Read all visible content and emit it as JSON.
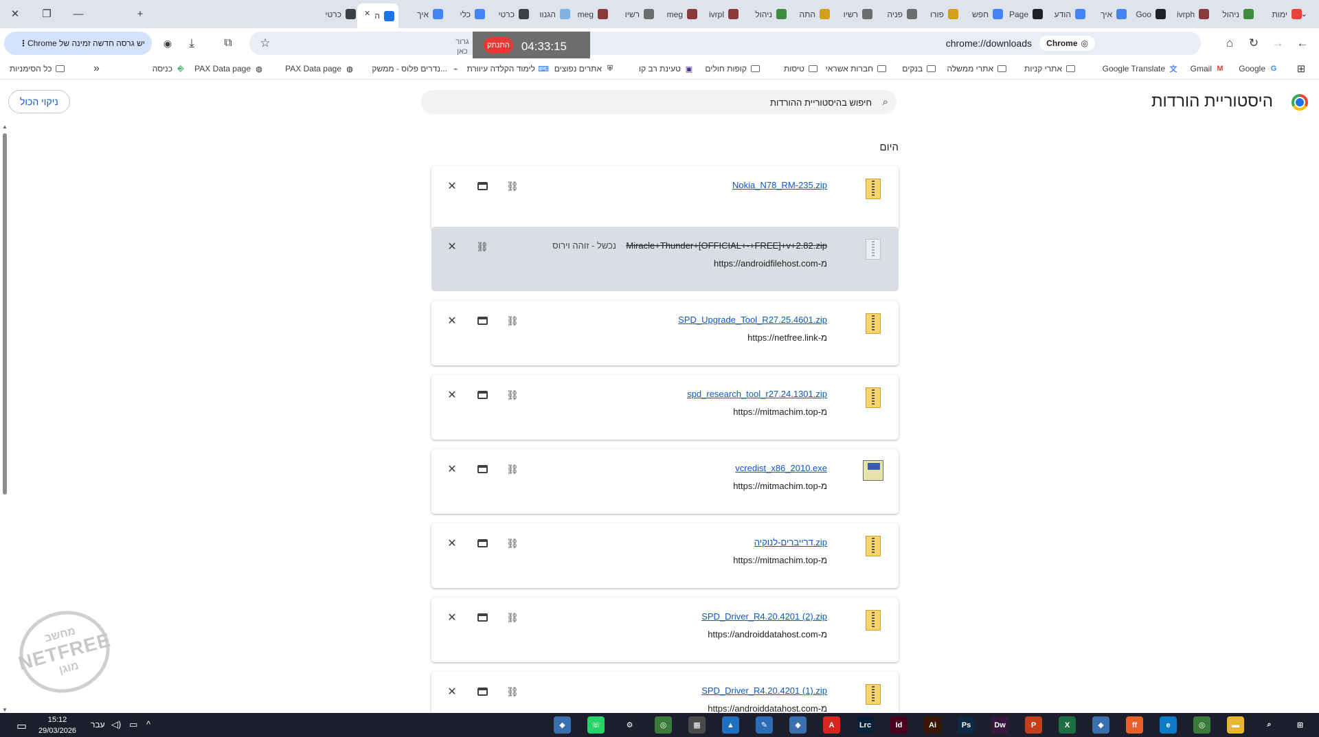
{
  "tabs": [
    {
      "label": "ימות",
      "icon": "gmail-icon",
      "color": "#ea4335"
    },
    {
      "label": "ניהול",
      "icon": "site-icon",
      "color": "#3d8b3d"
    },
    {
      "label": "ivrph",
      "icon": "shield-icon",
      "color": "#8a3a3a"
    },
    {
      "label": "Goo",
      "icon": "page-icon",
      "color": "#202124"
    },
    {
      "label": "איך",
      "icon": "google-icon",
      "color": "#4285f4"
    },
    {
      "label": "הודע",
      "icon": "google-icon",
      "color": "#4285f4"
    },
    {
      "label": "Page",
      "icon": "github-icon",
      "color": "#202124"
    },
    {
      "label": "חפש",
      "icon": "google-icon",
      "color": "#4285f4"
    },
    {
      "label": "פורו",
      "icon": "forum-icon",
      "color": "#d4a017"
    },
    {
      "label": "פניה",
      "icon": "shield-icon",
      "color": "#6d6d6d"
    },
    {
      "label": "רשיו",
      "icon": "shield-icon",
      "color": "#6d6d6d"
    },
    {
      "label": "התה",
      "icon": "site-icon",
      "color": "#d4a017"
    },
    {
      "label": "ניהול",
      "icon": "site-icon",
      "color": "#3d8b3d"
    },
    {
      "label": "ivrpl",
      "icon": "shield-icon",
      "color": "#8a3a3a"
    },
    {
      "label": "meg",
      "icon": "shield-icon",
      "color": "#8a3a3a"
    },
    {
      "label": "רשיו",
      "icon": "shield-icon",
      "color": "#6d6d6d"
    },
    {
      "label": "meg",
      "icon": "shield-icon",
      "color": "#8a3a3a"
    },
    {
      "label": "הגנוו",
      "icon": "snow-icon",
      "color": "#7fb2e5"
    },
    {
      "label": "כרטי",
      "icon": "chrome-icon",
      "color": "#3c4043"
    },
    {
      "label": "כלי",
      "icon": "google-icon",
      "color": "#4285f4"
    },
    {
      "label": "איך",
      "icon": "google-icon",
      "color": "#4285f4"
    },
    {
      "label": "ה",
      "icon": "download-icon",
      "color": "#1a73e8",
      "active": true
    },
    {
      "label": "כרטי",
      "icon": "chrome-icon",
      "color": "#3c4043"
    }
  ],
  "toolbar": {
    "url": "chrome://downloads",
    "chip_label": "Chrome",
    "update_label": "יש גרסה חדשה זמינה של Chrome"
  },
  "bookmarks": [
    {
      "label": "Google",
      "icon": "google-icon"
    },
    {
      "label": "Gmail",
      "icon": "gmail-icon"
    },
    {
      "label": "Google Translate",
      "icon": "translate-icon"
    },
    {
      "label": "אתרי קניות",
      "icon": "folder-icon"
    },
    {
      "label": "אתרי ממשלה",
      "icon": "folder-icon"
    },
    {
      "label": "בנקים",
      "icon": "folder-icon"
    },
    {
      "label": "חברות אשראי",
      "icon": "folder-icon"
    },
    {
      "label": "טיסות",
      "icon": "folder-icon"
    },
    {
      "label": "קופות חולים",
      "icon": "folder-icon"
    },
    {
      "label": "טעינת רב קו",
      "icon": "ravkav-icon"
    },
    {
      "label": "אתרים נפוצים",
      "icon": "shield-icon"
    },
    {
      "label": "לימוד הקלדה עיוורת",
      "icon": "typing-icon"
    },
    {
      "label": "נדרים פלוס - ממשק...",
      "icon": "link-icon"
    },
    {
      "label": "PAX Data page",
      "icon": "globe-icon"
    },
    {
      "label": "PAX Data page",
      "icon": "globe-icon"
    },
    {
      "label": "כניסה",
      "icon": "login-icon"
    }
  ],
  "bookmarks_more": "»",
  "bookmarks_all": "כל הסימניות",
  "page": {
    "title": "היסטוריית הורדות",
    "search_placeholder": "חיפוש בהיסטוריית ההורדות",
    "clear_all": "ניקוי הכול",
    "section": "היום"
  },
  "downloads": [
    {
      "file": "Nokia_N78_RM-235.zip",
      "source": "",
      "status": "",
      "failed": false,
      "icon": "zip-icon"
    },
    {
      "file": "Miracle+Thunder+[OFFICIAL+-+FREE]+v+2.82.zip",
      "source": "https://androidfilehost.com-מ",
      "status": "נכשל - זוהה וירוס",
      "failed": true,
      "icon": "zip-icon"
    },
    {
      "file": "SPD_Upgrade_Tool_R27.25.4601.zip",
      "source": "https://netfree.link-מ",
      "status": "",
      "failed": false,
      "icon": "zip-icon"
    },
    {
      "file": "spd_research_tool_r27.24.1301.zip",
      "source": "https://mitmachim.top-מ",
      "status": "",
      "failed": false,
      "icon": "zip-icon"
    },
    {
      "file": "vcredist_x86_2010.exe",
      "source": "https://mitmachim.top-מ",
      "status": "",
      "failed": false,
      "icon": "exe-icon"
    },
    {
      "file": "דרייברים-לנוקיה.zip",
      "source": "https://mitmachim.top-מ",
      "status": "",
      "failed": false,
      "icon": "zip-icon"
    },
    {
      "file": "SPD_Driver_R4.20.4201 (2).zip",
      "source": "https://androiddatahost.com-מ",
      "status": "",
      "failed": false,
      "icon": "zip-icon"
    },
    {
      "file": "SPD_Driver_R4.20.4201 (1).zip",
      "source": "https://androiddatahost.com-מ",
      "status": "",
      "failed": false,
      "icon": "zip-icon"
    }
  ],
  "overlay": {
    "timer": "04:33:15",
    "stop_label": "התנתק",
    "drag_hint": "גרור כאן"
  },
  "watermark": {
    "top": "מחשב",
    "mid": "NETFREE",
    "bottom": "מוגן"
  },
  "taskbar": {
    "time": "15:12",
    "date": "29/03/2026",
    "lang": "עבר",
    "apps": [
      "start-icon",
      "search-icon",
      "explorer-icon",
      "chrome-icon",
      "edge-icon",
      "firefox-icon",
      "app-icon",
      "excel-icon",
      "powerpoint-icon",
      "dreamweaver-icon",
      "photoshop-icon",
      "illustrator-icon",
      "indesign-icon",
      "lightroom-icon",
      "acrobat-icon",
      "app-icon",
      "paint-icon",
      "photos-icon",
      "calculator-icon",
      "chrome-icon",
      "settings-icon",
      "whatsapp-icon",
      "app-icon"
    ]
  },
  "colors": {
    "accent": "#0b57d0",
    "tabstrip": "#dfe3eb",
    "failed_card": "#d9dee5",
    "taskbar": "#1c1f2b"
  }
}
